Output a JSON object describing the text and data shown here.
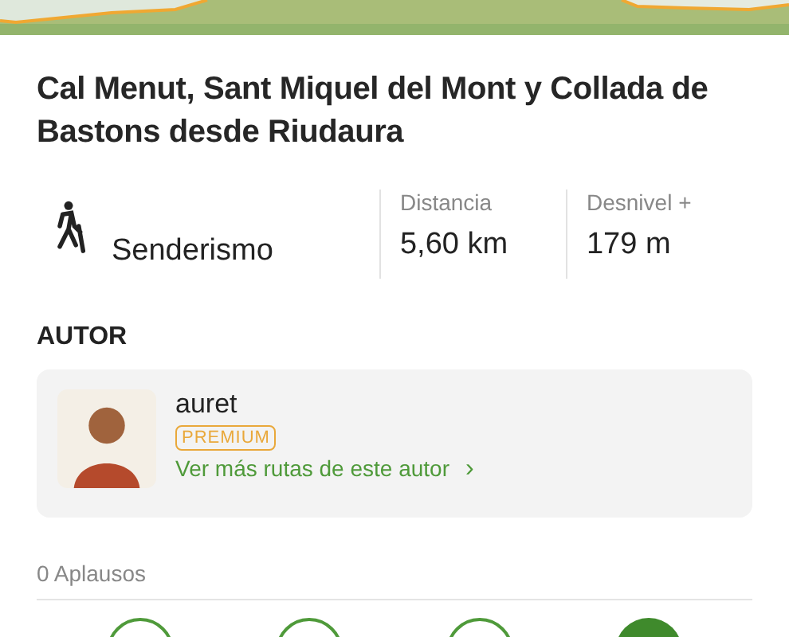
{
  "title": "Cal Menut, Sant Miquel del Mont y Collada de Bastons desde Riudaura",
  "activity": {
    "label": "Senderismo"
  },
  "stats": [
    {
      "label": "Distancia",
      "value": "5,60 km"
    },
    {
      "label": "Desnivel +",
      "value": "179 m"
    }
  ],
  "author_section": {
    "heading": "AUTOR",
    "name": "auret",
    "badge": "PREMIUM",
    "link": "Ver más rutas de este autor",
    "chevron": "›"
  },
  "applause": "0 Aplausos",
  "actions": [
    {
      "kind": "outline"
    },
    {
      "kind": "outline"
    },
    {
      "kind": "outline"
    },
    {
      "kind": "filled"
    }
  ]
}
